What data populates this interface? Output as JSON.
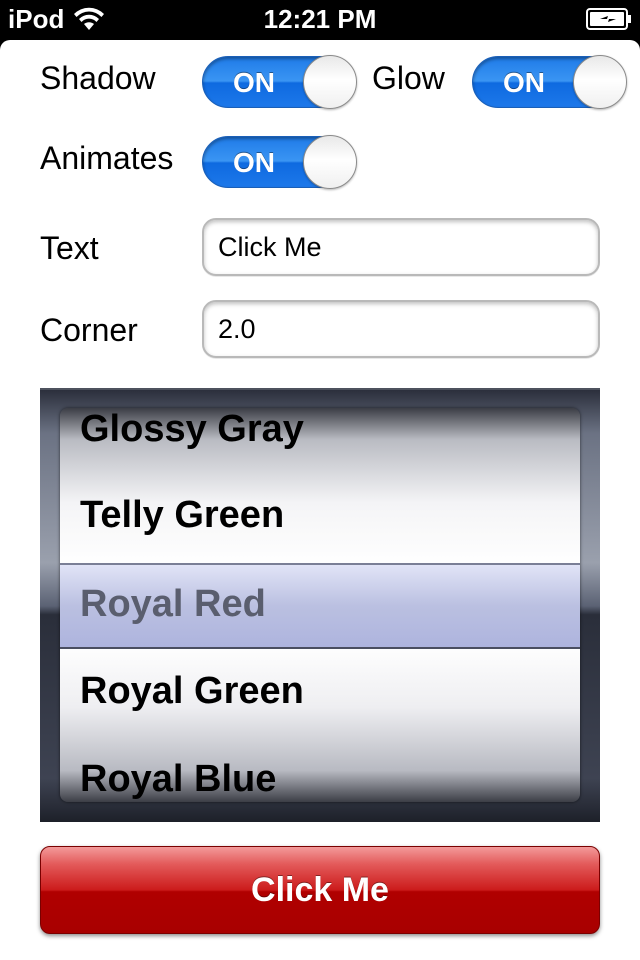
{
  "status_bar": {
    "device": "iPod",
    "time": "12:21 PM",
    "wifi_icon": "wifi-icon",
    "battery_icon": "battery-charging-icon"
  },
  "settings": {
    "shadow": {
      "label": "Shadow",
      "state": "ON"
    },
    "glow": {
      "label": "Glow",
      "state": "ON"
    },
    "animates": {
      "label": "Animates",
      "state": "ON"
    },
    "text": {
      "label": "Text",
      "value": "Click Me"
    },
    "corner": {
      "label": "Corner",
      "value": "2.0"
    }
  },
  "picker": {
    "items": [
      "Glossy Gray",
      "Telly Green",
      "Royal Red",
      "Royal Green",
      "Royal Blue"
    ],
    "selected": "Royal Red"
  },
  "button": {
    "label": "Click Me"
  },
  "colors": {
    "switch_on": "#1f7be8",
    "button_red": "#c00000",
    "picker_selection": "#9aa3d6"
  }
}
